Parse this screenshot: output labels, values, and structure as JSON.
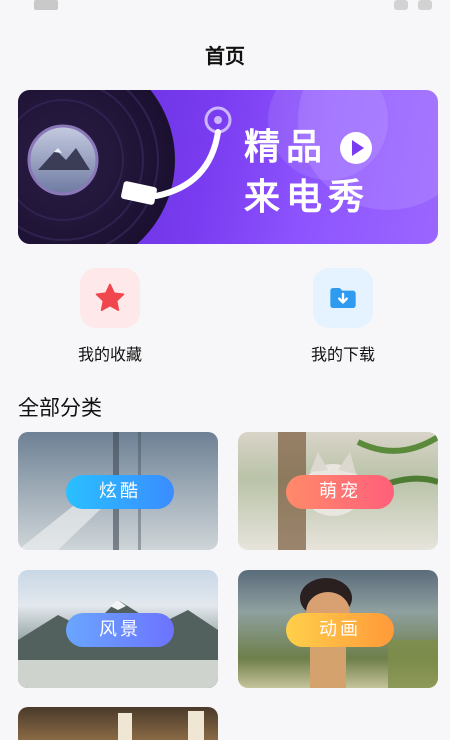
{
  "page": {
    "title": "首页"
  },
  "banner": {
    "line1": "精品",
    "line2": "来电秀",
    "arrows": ">>>"
  },
  "quick_links": [
    {
      "label": "我的收藏",
      "icon": "star-icon"
    },
    {
      "label": "我的下载",
      "icon": "download-folder-icon"
    }
  ],
  "section": {
    "title": "全部分类"
  },
  "categories": [
    {
      "label": "炫酷"
    },
    {
      "label": "萌宠"
    },
    {
      "label": "风景"
    },
    {
      "label": "动画"
    }
  ],
  "colors": {
    "banner_purple": "#7a3cf0",
    "star_red": "#f0464d",
    "folder_blue": "#2f9bf0"
  }
}
